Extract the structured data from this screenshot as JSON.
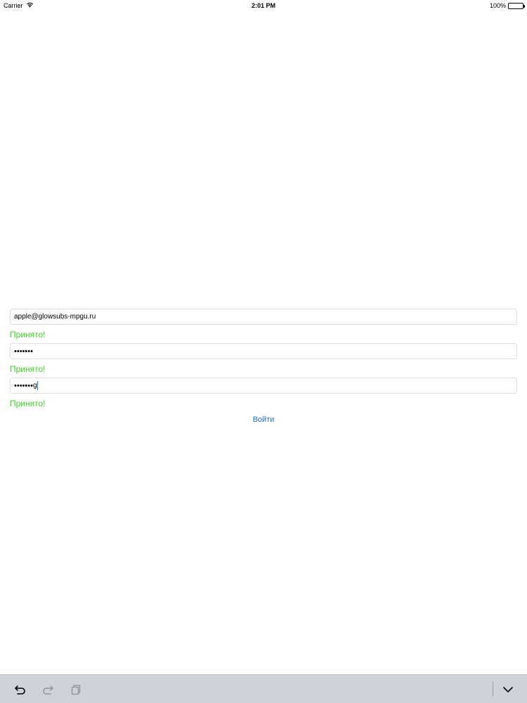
{
  "status_bar": {
    "carrier": "Carrier",
    "time": "2:01 PM",
    "battery_label": "100%",
    "battery_level": 1.0,
    "wifi_icon": "wifi-icon"
  },
  "form": {
    "email_value": "apple@glowsubs-mpgu.ru",
    "password_value": "•••••••",
    "confirm_value": "•••••••",
    "confirm_last_char": "g",
    "email_status": "Принято!",
    "password_status": "Принято!",
    "confirm_status": "Принято!",
    "login_label": "Войти"
  },
  "colors": {
    "accepted": "#3ad524",
    "link": "#1a6fd8",
    "toolbar": "#cfd2d9"
  },
  "toolbar": {
    "undo_icon": "undo-icon",
    "redo_icon": "redo-icon",
    "paste_icon": "paste-icon",
    "dismiss_icon": "chevron-down-icon"
  }
}
